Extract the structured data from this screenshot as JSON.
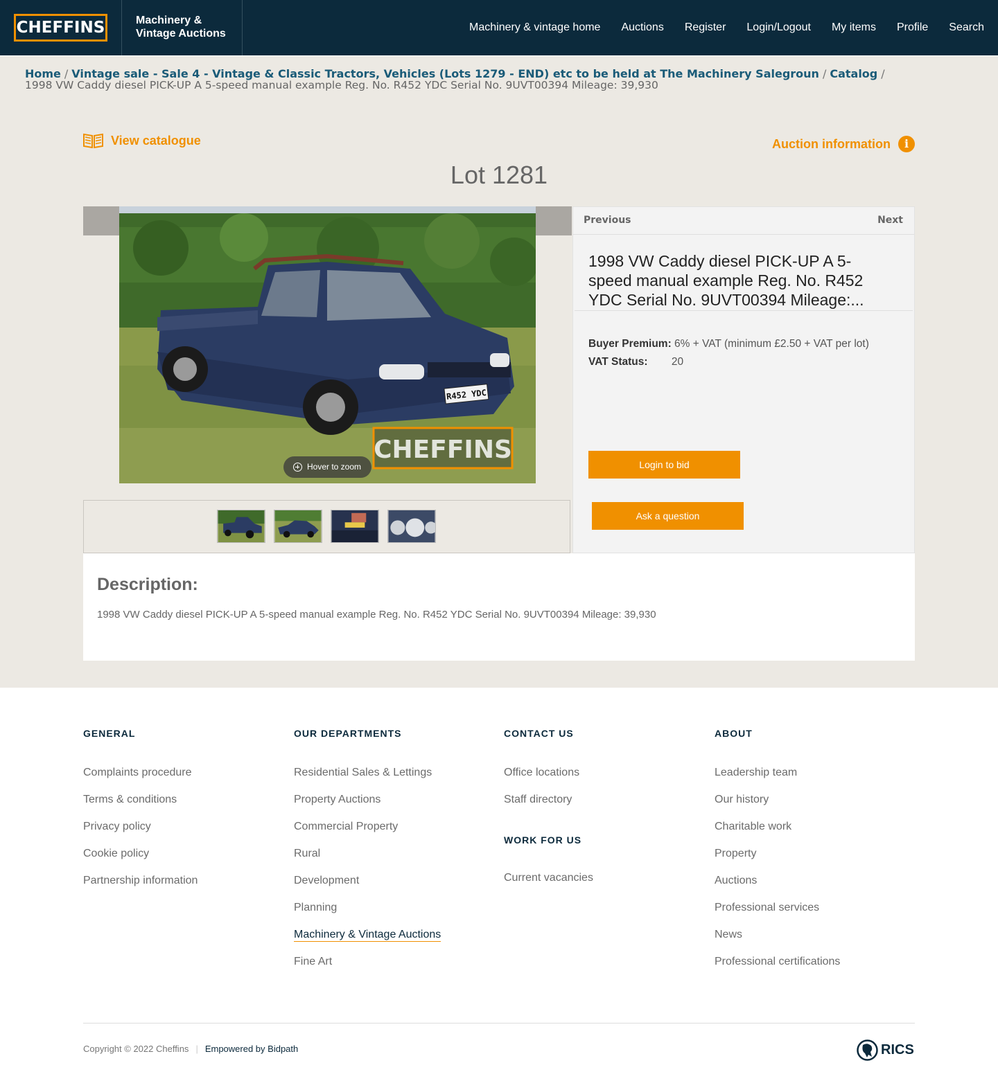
{
  "header": {
    "logo_text": "CHEFFINS",
    "brand_line1": "Machinery &",
    "brand_line2": "Vintage Auctions",
    "nav": [
      "Machinery & vintage home",
      "Auctions",
      "Register",
      "Login/Logout",
      "My items",
      "Profile",
      "Search"
    ]
  },
  "breadcrumb": {
    "home": "Home",
    "sale": "Vintage sale - Sale 4 - Vintage & Classic Tractors, Vehicles (Lots 1279 - END) etc to be held at The Machinery Salegroun",
    "catalog": "Catalog",
    "sep": "/",
    "current": "1998 VW Caddy diesel PICK-UP A 5-speed manual example Reg. No. R452 YDC Serial No. 9UVT00394 Mileage: 39,930"
  },
  "toolbar": {
    "view_catalogue": "View catalogue",
    "auction_information": "Auction information",
    "info_glyph": "i"
  },
  "lot": {
    "title": "Lot 1281",
    "name": "1998 VW Caddy diesel PICK-UP A 5-speed manual example Reg. No. R452 YDC Serial No. 9UVT00394 Mileage:...",
    "previous": "Previous",
    "next": "Next",
    "buyer_premium_label": "Buyer Premium:",
    "buyer_premium_value": "6% + VAT (minimum £2.50 + VAT per lot)",
    "vat_status_label": "VAT Status:",
    "vat_status_value": "20",
    "login_to_bid": "Login to bid",
    "ask_question": "Ask a question"
  },
  "image": {
    "zoom_hint": "Hover to zoom",
    "watermark": "CHEFFINS",
    "plate": "R452 YDC",
    "thumb_count": 4
  },
  "description": {
    "heading": "Description:",
    "text": "1998 VW Caddy diesel PICK-UP A 5-speed manual example Reg. No. R452 YDC Serial No. 9UVT00394 Mileage: 39,930"
  },
  "footer": {
    "general": {
      "heading": "GENERAL",
      "items": [
        "Complaints procedure",
        "Terms & conditions",
        "Privacy policy",
        "Cookie policy",
        "Partnership information"
      ]
    },
    "departments": {
      "heading": "OUR DEPARTMENTS",
      "items": [
        "Residential Sales & Lettings",
        "Property Auctions",
        "Commercial Property",
        "Rural",
        "Development",
        "Planning",
        "Machinery & Vintage Auctions",
        "Fine Art"
      ]
    },
    "contact": {
      "heading": "CONTACT US",
      "items": [
        "Office locations",
        "Staff directory"
      ]
    },
    "work": {
      "heading": "WORK FOR US",
      "item": "Current vacancies"
    },
    "about": {
      "heading": "ABOUT",
      "items": [
        "Leadership team",
        "Our history",
        "Charitable work",
        "Property",
        "Auctions",
        "Professional services",
        "News",
        "Professional certifications"
      ]
    },
    "copyright": "Copyright © 2022 Cheffins",
    "pipe": "|",
    "powered": "Empowered by Bidpath",
    "rics": "RICS"
  },
  "colors": {
    "navy": "#0c2a3c",
    "orange": "#f09000",
    "band": "#ece9e3",
    "link_blue": "#1a5b78"
  }
}
